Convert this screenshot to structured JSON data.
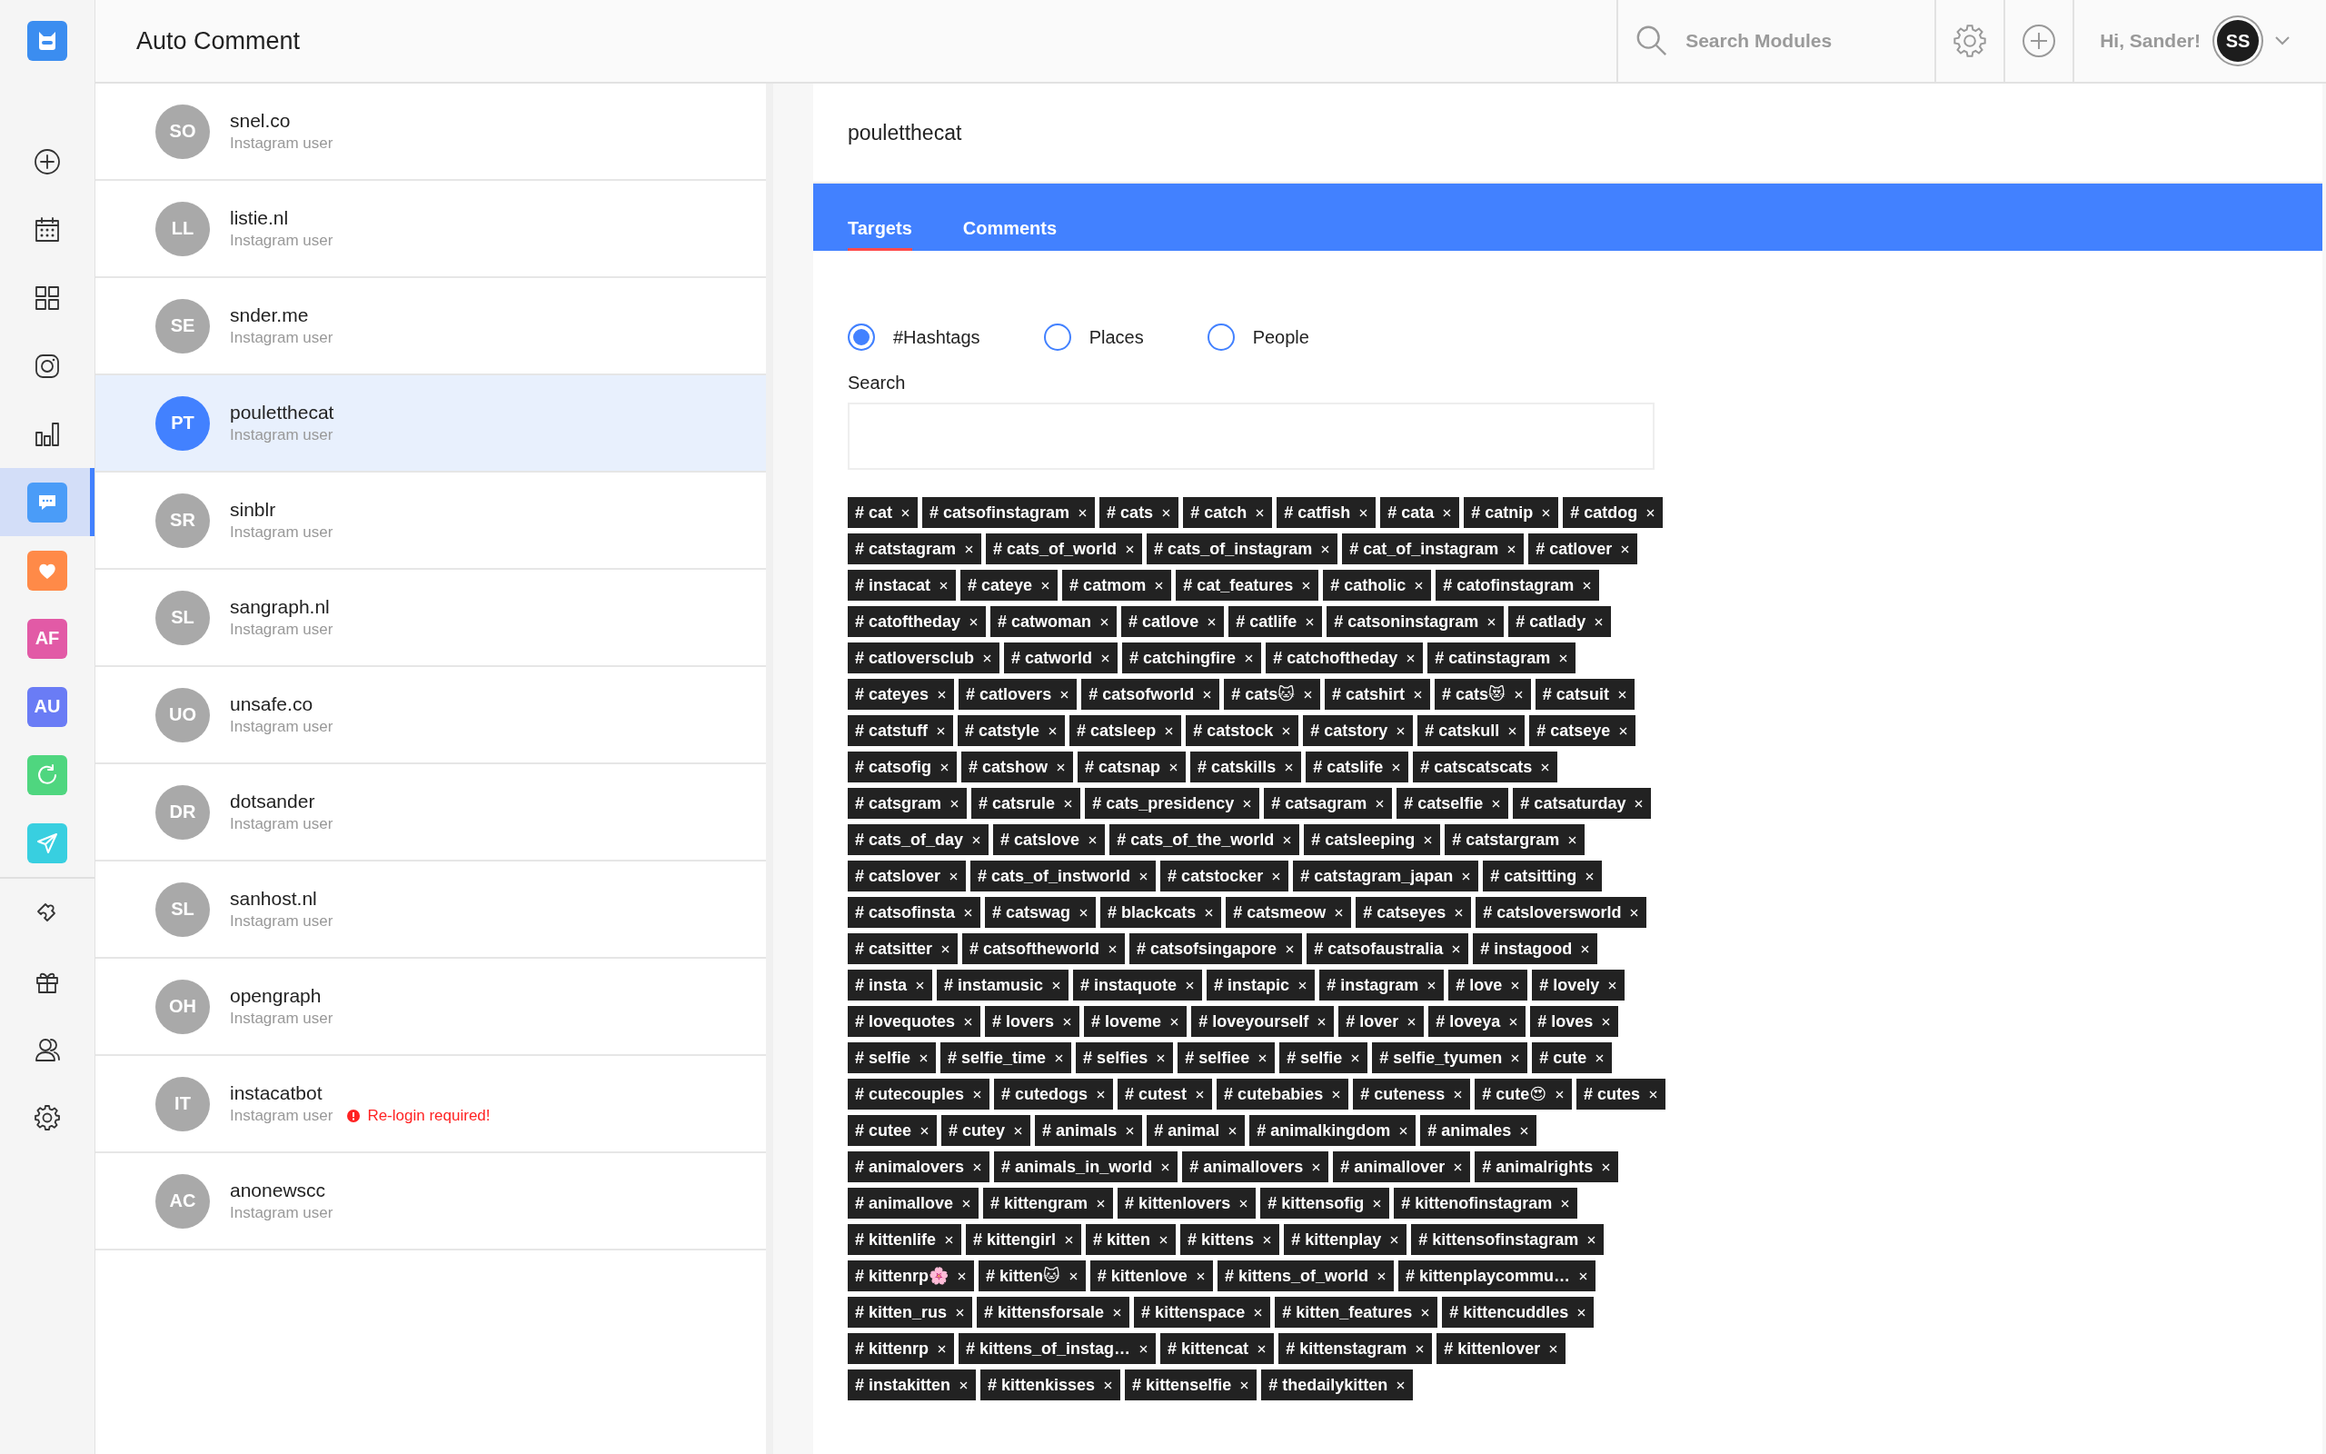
{
  "sidebar": {
    "items": [
      {
        "kind": "logo"
      },
      {
        "kind": "plus",
        "selected": false
      },
      {
        "kind": "calendar",
        "selected": false
      },
      {
        "kind": "grid",
        "selected": false
      },
      {
        "kind": "camera",
        "selected": false
      },
      {
        "kind": "chart",
        "selected": false
      },
      {
        "kind": "comment",
        "selected": true,
        "color": "#4a9cf8"
      },
      {
        "kind": "heart",
        "selected": false,
        "color": "#ff8a48"
      },
      {
        "kind": "badge",
        "text": "AF",
        "selected": false,
        "color": "#e25aa6"
      },
      {
        "kind": "badge",
        "text": "AU",
        "selected": false,
        "color": "#6a7cf5"
      },
      {
        "kind": "refresh",
        "selected": false,
        "color": "#4fd67f"
      },
      {
        "kind": "send",
        "selected": false,
        "color": "#38cfe0"
      },
      {
        "kind": "divider"
      },
      {
        "kind": "puzzle",
        "selected": false
      },
      {
        "kind": "gift",
        "selected": false
      },
      {
        "kind": "users",
        "selected": false
      },
      {
        "kind": "gear",
        "selected": false
      }
    ]
  },
  "header": {
    "title": "Auto Comment",
    "search_placeholder": "Search Modules",
    "greeting": "Hi, Sander!",
    "avatar": "SS"
  },
  "accounts": [
    {
      "initials": "SO",
      "name": "snel.co",
      "subtitle": "Instagram user",
      "selected": false
    },
    {
      "initials": "LL",
      "name": "listie.nl",
      "subtitle": "Instagram user",
      "selected": false
    },
    {
      "initials": "SE",
      "name": "snder.me",
      "subtitle": "Instagram user",
      "selected": false
    },
    {
      "initials": "PT",
      "name": "pouletthecat",
      "subtitle": "Instagram user",
      "selected": true
    },
    {
      "initials": "SR",
      "name": "sinblr",
      "subtitle": "Instagram user",
      "selected": false
    },
    {
      "initials": "SL",
      "name": "sangraph.nl",
      "subtitle": "Instagram user",
      "selected": false
    },
    {
      "initials": "UO",
      "name": "unsafe.co",
      "subtitle": "Instagram user",
      "selected": false
    },
    {
      "initials": "DR",
      "name": "dotsander",
      "subtitle": "Instagram user",
      "selected": false
    },
    {
      "initials": "SL",
      "name": "sanhost.nl",
      "subtitle": "Instagram user",
      "selected": false
    },
    {
      "initials": "OH",
      "name": "opengraph",
      "subtitle": "Instagram user",
      "selected": false
    },
    {
      "initials": "IT",
      "name": "instacatbot",
      "subtitle": "Instagram user",
      "selected": false,
      "warning": "Re-login required!"
    },
    {
      "initials": "AC",
      "name": "anonewscc",
      "subtitle": "Instagram user",
      "selected": false
    }
  ],
  "panel": {
    "title": "pouletthecat",
    "tabs": [
      {
        "label": "Targets",
        "selected": true
      },
      {
        "label": "Comments",
        "selected": false
      }
    ],
    "target_types": [
      {
        "label": "#Hashtags",
        "selected": true
      },
      {
        "label": "Places",
        "selected": false
      },
      {
        "label": "People",
        "selected": false
      }
    ],
    "search_label": "Search",
    "tags": [
      "# cat",
      "# catsofinstagram",
      "# cats",
      "# catch",
      "# catfish",
      "# cata",
      "# catnip",
      "# catdog",
      "# catstagram",
      "# cats_of_world",
      "# cats_of_instagram",
      "# cat_of_instagram",
      "# catlover",
      "# instacat",
      "# cateye",
      "# catmom",
      "# cat_features",
      "# catholic",
      "# catofinstagram",
      "# catoftheday",
      "# catwoman",
      "# catlove",
      "# catlife",
      "# catsoninstagram",
      "# catlady",
      "# catloversclub",
      "# catworld",
      "# catchingfire",
      "# catchoftheday",
      "# catinstagram",
      "# cateyes",
      "# catlovers",
      "# catsofworld",
      "# cats🐱",
      "# catshirt",
      "# cats😻",
      "# catsuit",
      "# catstuff",
      "# catstyle",
      "# catsleep",
      "# catstock",
      "# catstory",
      "# catskull",
      "# catseye",
      "# catsofig",
      "# catshow",
      "# catsnap",
      "# catskills",
      "# catslife",
      "# catscatscats",
      "# catsgram",
      "# catsrule",
      "# cats_presidency",
      "# catsagram",
      "# catselfie",
      "# catsaturday",
      "# cats_of_day",
      "# catslove",
      "# cats_of_the_world",
      "# catsleeping",
      "# catstargram",
      "# catslover",
      "# cats_of_instworld",
      "# catstocker",
      "# catstagram_japan",
      "# catsitting",
      "# catsofinsta",
      "# catswag",
      "# blackcats",
      "# catsmeow",
      "# catseyes",
      "# catsloversworld",
      "# catsitter",
      "# catsoftheworld",
      "# catsofsingapore",
      "# catsofaustralia",
      "# instagood",
      "# insta",
      "# instamusic",
      "# instaquote",
      "# instapic",
      "# instagram",
      "# love",
      "# lovely",
      "# lovequotes",
      "# lovers",
      "# loveme",
      "# loveyourself",
      "# lover",
      "# loveya",
      "# loves",
      "# selfie",
      "# selfie_time",
      "# selfies",
      "# selfiee",
      "# selfie",
      "# selfie_tyumen",
      "# cute",
      "# cutecouples",
      "# cutedogs",
      "# cutest",
      "# cutebabies",
      "# cuteness",
      "# cute😍",
      "# cutes",
      "# cutee",
      "# cutey",
      "# animals",
      "# animal",
      "# animalkingdom",
      "# animales",
      "# animalovers",
      "# animals_in_world",
      "# animallovers",
      "# animallover",
      "# animalrights",
      "# animallove",
      "# kittengram",
      "# kittenlovers",
      "# kittensofig",
      "# kittenofinstagram",
      "# kittenlife",
      "# kittengirl",
      "# kitten",
      "# kittens",
      "# kittenplay",
      "# kittensofinstagram",
      "# kittenrp🌸",
      "# kitten🐱",
      "# kittenlove",
      "# kittens_of_world",
      "# kittenplaycommu…",
      "# kitten_rus",
      "# kittensforsale",
      "# kittenspace",
      "# kitten_features",
      "# kittencuddles",
      "# kittenrp",
      "# kittens_of_instag…",
      "# kittencat",
      "# kittenstagram",
      "# kittenlover",
      "# instakitten",
      "# kittenkisses",
      "# kittenselfie",
      "# thedailykitten"
    ]
  }
}
